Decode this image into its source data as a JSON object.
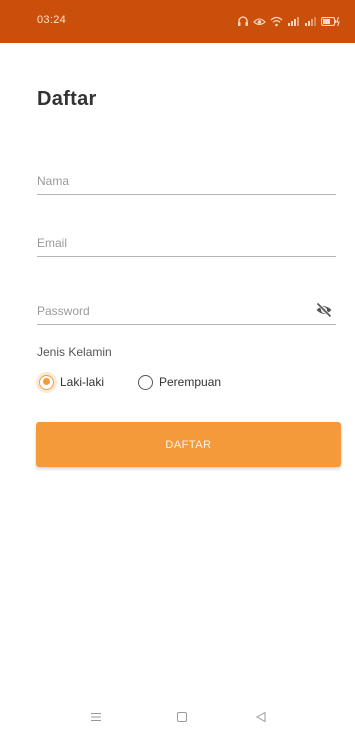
{
  "status_bar": {
    "time": "03:24",
    "icons": [
      "headset-icon",
      "eye-comfort-icon",
      "wifi-icon",
      "signal-icon",
      "signal-icon",
      "battery-charging-icon"
    ]
  },
  "form": {
    "title": "Daftar",
    "name_placeholder": "Nama",
    "email_placeholder": "Email",
    "password_placeholder": "Password",
    "password_toggle_icon": "eye-off-icon",
    "gender": {
      "label": "Jenis Kelamin",
      "options": [
        {
          "label": "Laki-laki",
          "selected": true
        },
        {
          "label": "Perempuan",
          "selected": false
        }
      ]
    },
    "submit_label": "DAFTAR"
  },
  "nav_bar": {
    "icons": [
      "menu-icon",
      "home-icon",
      "back-icon"
    ]
  },
  "colors": {
    "status_bar": "#c94f0a",
    "accent": "#f59a3a",
    "title_text": "#333333",
    "placeholder": "#9a9a9a"
  }
}
